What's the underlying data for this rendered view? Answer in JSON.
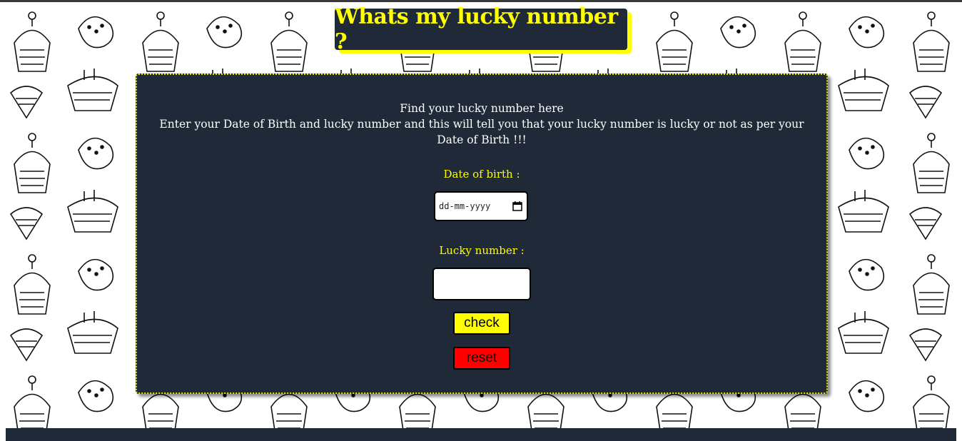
{
  "header": {
    "title": "Whats my lucky number ?"
  },
  "intro": {
    "line1": "Find your lucky number here",
    "line2": "Enter your Date of Birth and lucky number and this will tell you that your lucky number is lucky or not as per your Date of Birth !!!"
  },
  "form": {
    "dob_label": "Date of birth :",
    "dob_placeholder": "dd-mm-yyyy",
    "lucky_label": "Lucky number :",
    "lucky_value": "",
    "check_label": "check",
    "reset_label": "reset"
  },
  "colors": {
    "accent": "#ffff00",
    "panel": "#1f2937",
    "reset": "#ff0000"
  },
  "icons": {
    "date_picker": "calendar-icon",
    "background": "cupcake-doodle-pattern"
  }
}
